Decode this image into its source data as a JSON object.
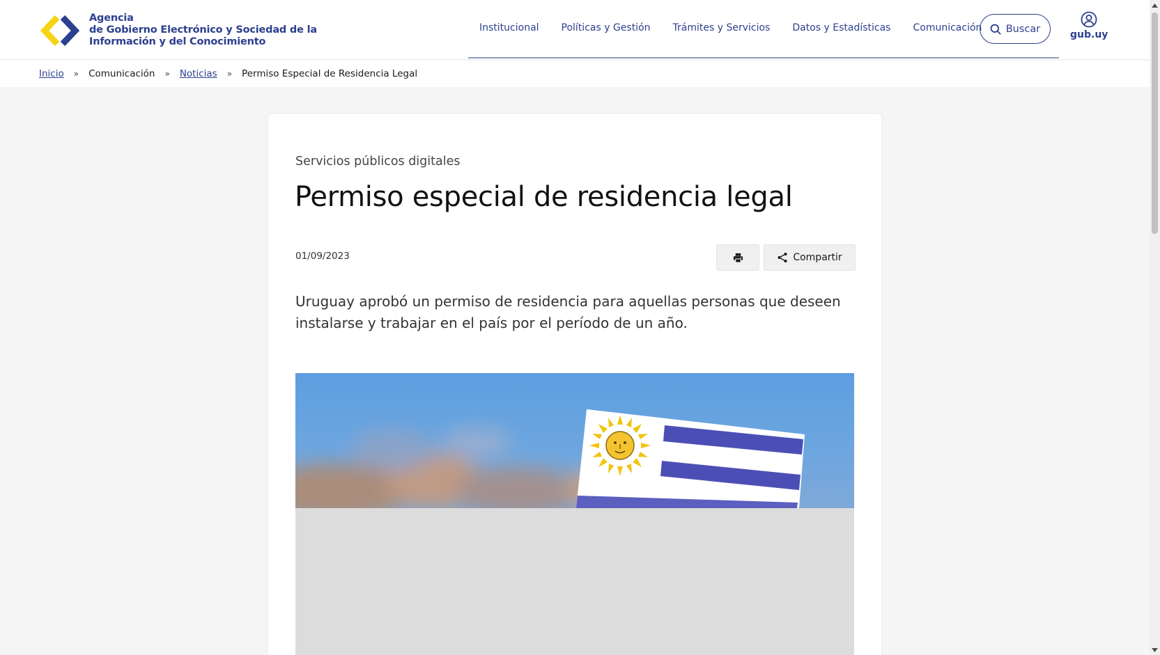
{
  "header": {
    "logo_lines": [
      "Agencia",
      "de Gobierno Electrónico y Sociedad de la",
      "Información y del Conocimiento"
    ],
    "logo_colors": {
      "left_chevron": "#f6d313",
      "right_chevron": "#2d3f8f"
    },
    "nav": [
      "Institucional",
      "Políticas y Gestión",
      "Trámites y Servicios",
      "Datos y Estadísticas",
      "Comunicación"
    ],
    "search_label": "Buscar",
    "gub_label": "gub.uy",
    "accent_color": "#2d3f8f"
  },
  "breadcrumb": {
    "items": [
      "Inicio",
      "Comunicación",
      "Noticias",
      "Permiso Especial de Residencia Legal"
    ],
    "separator": "»"
  },
  "article": {
    "category": "Servicios públicos digitales",
    "title": "Permiso especial de residencia legal",
    "date": "01/09/2023",
    "share_label": "Compartir",
    "lead": "Uruguay aprobó un permiso de residencia para aquellas personas que deseen instalarse y trabajar en el país por el período de un año.",
    "image": {
      "subject": "uruguay-flag"
    }
  }
}
